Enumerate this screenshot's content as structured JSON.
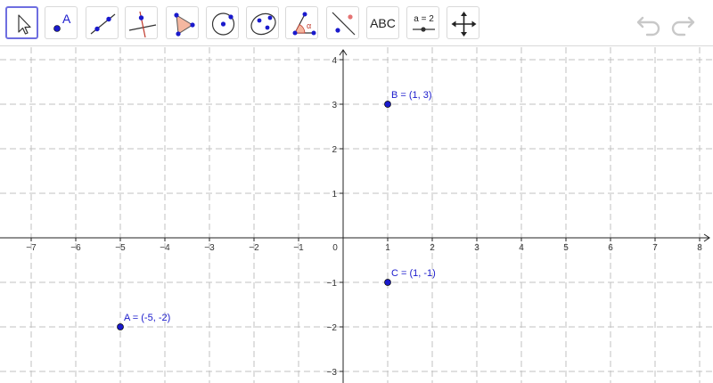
{
  "toolbar": {
    "tools": [
      {
        "name": "move-tool",
        "icon": "arrow-pointer-icon",
        "selected": true
      },
      {
        "name": "point-tool",
        "icon": "point-icon",
        "label": "A"
      },
      {
        "name": "line-tool",
        "icon": "line-through-points-icon"
      },
      {
        "name": "perpendicular-line-tool",
        "icon": "perpendicular-line-icon"
      },
      {
        "name": "polygon-tool",
        "icon": "polygon-icon"
      },
      {
        "name": "circle-tool",
        "icon": "circle-center-point-icon"
      },
      {
        "name": "ellipse-tool",
        "icon": "ellipse-icon"
      },
      {
        "name": "angle-tool",
        "icon": "angle-icon",
        "label": "α"
      },
      {
        "name": "reflect-tool",
        "icon": "reflect-about-line-icon"
      },
      {
        "name": "text-tool",
        "icon": "text-icon",
        "label": "ABC"
      },
      {
        "name": "slider-tool",
        "icon": "slider-icon",
        "label": "a = 2"
      },
      {
        "name": "move-graphics-tool",
        "icon": "move-graphics-icon"
      }
    ],
    "undo": {
      "icon": "undo-icon"
    },
    "redo": {
      "icon": "redo-icon"
    }
  },
  "graph": {
    "x_ticks": [
      "−7",
      "−6",
      "−5",
      "−4",
      "−3",
      "−2",
      "−1",
      "1",
      "2",
      "3",
      "4",
      "5",
      "6",
      "7",
      "8"
    ],
    "y_ticks": [
      "4",
      "3",
      "2",
      "1",
      "−1",
      "−2",
      "−3"
    ],
    "origin_label": "0",
    "points": [
      {
        "name": "A",
        "x": -5,
        "y": -2,
        "label": "A = (-5, -2)"
      },
      {
        "name": "B",
        "x": 1,
        "y": 3,
        "label": "B = (1, 3)"
      },
      {
        "name": "C",
        "x": 1,
        "y": -1,
        "label": "C = (1, -1)"
      }
    ]
  },
  "colors": {
    "point": "#1a1acc",
    "axis": "#222222",
    "grid": "#c0c0c0",
    "selected_border": "#6e6ee0"
  }
}
